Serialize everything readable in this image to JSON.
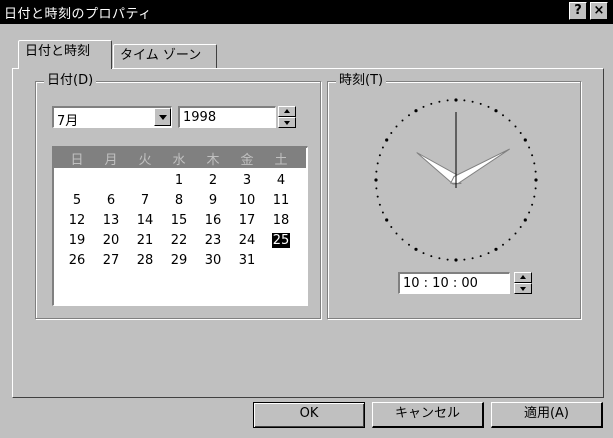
{
  "window": {
    "title": "日付と時刻のプロパティ",
    "help_label": "?",
    "close_label": "×"
  },
  "tabs": [
    {
      "label": "日付と時刻",
      "active": true
    },
    {
      "label": "タイム ゾーン",
      "active": false
    }
  ],
  "date_group": {
    "legend": "日付(D)",
    "month": "7月",
    "year": "1998",
    "weekdays": [
      "日",
      "月",
      "火",
      "水",
      "木",
      "金",
      "土"
    ],
    "days": [
      [
        "",
        "",
        "",
        "1",
        "2",
        "3",
        "4"
      ],
      [
        "5",
        "6",
        "7",
        "8",
        "9",
        "10",
        "11"
      ],
      [
        "12",
        "13",
        "14",
        "15",
        "16",
        "17",
        "18"
      ],
      [
        "19",
        "20",
        "21",
        "22",
        "23",
        "24",
        "25"
      ],
      [
        "26",
        "27",
        "28",
        "29",
        "30",
        "31",
        ""
      ]
    ],
    "selected_day": "25"
  },
  "time_group": {
    "legend": "時刻(T)",
    "time": "10 : 10 : 00",
    "clock_hour": 10,
    "clock_minute": 10,
    "clock_second": 0
  },
  "buttons": {
    "ok": "OK",
    "cancel": "キャンセル",
    "apply": "適用(A)"
  }
}
